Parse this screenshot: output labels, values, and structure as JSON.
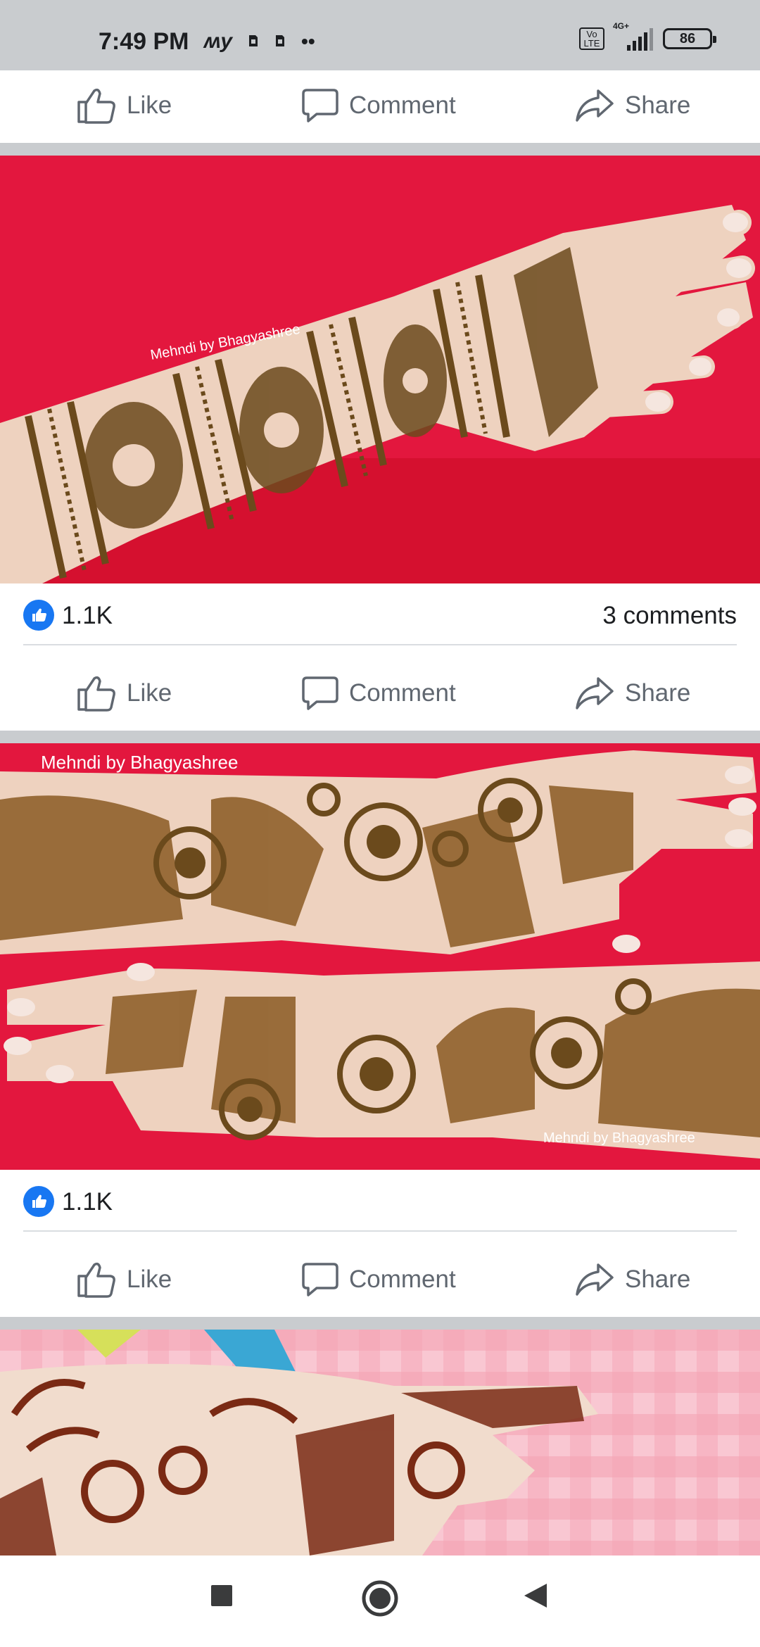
{
  "status_bar": {
    "time": "7:49 PM",
    "left_icons": [
      "carrier-logo-icon",
      "notification-icon",
      "notification-icon",
      "more-dots-icon"
    ],
    "volte": "Vo LTE",
    "network": "4G+",
    "battery": "86"
  },
  "actions": {
    "like": "Like",
    "comment": "Comment",
    "share": "Share"
  },
  "posts": [
    {
      "watermark": "Mehndi by Bhagyashree",
      "reactions": "1.1K",
      "comments": "3 comments"
    },
    {
      "watermark": "Mehndi by Bhagyashree",
      "watermark_secondary": "Mehndi by Bhagyashree",
      "reactions": "1.1K",
      "comments": ""
    },
    {
      "watermark": ""
    }
  ],
  "colors": {
    "facebook_blue": "#1877f2",
    "action_grey": "#606770",
    "photo_red": "#e3173e",
    "henna_brown": "#6b4a1c",
    "skin": "#eed2bf",
    "pink_bg": "#f5a8b8"
  },
  "nav": {
    "recents": "square-recents-icon",
    "home": "circle-home-icon",
    "back": "triangle-back-icon"
  }
}
